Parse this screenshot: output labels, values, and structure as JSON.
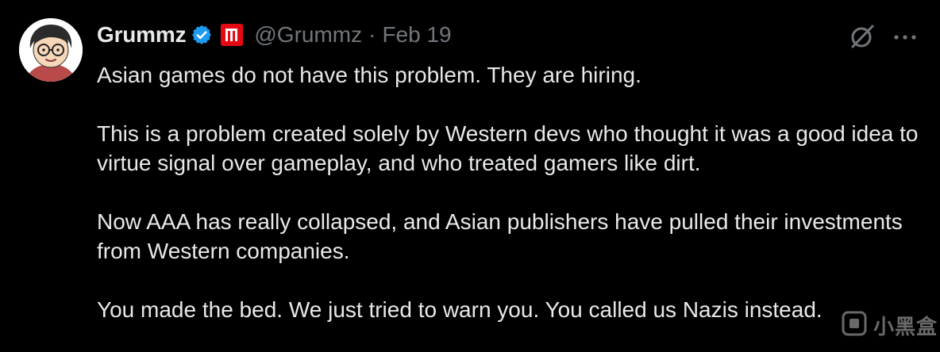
{
  "author": {
    "display_name": "Grummz",
    "handle": "@Grummz",
    "separator": "·",
    "date": "Feb 19",
    "avatar_icon": "cartoon-avatar",
    "verified_icon": "verified-check-icon",
    "affiliate_badge_icon": "red-affiliate-badge-icon",
    "verified_color": "#1d9bf0",
    "affiliate_color": "#e50914"
  },
  "actions": {
    "grok_icon": "grok-icon",
    "more_icon": "more-dots-icon"
  },
  "tweet": {
    "paragraphs": [
      "Asian games do not have this problem. They are hiring.",
      "This is a problem created solely by Western devs who thought it was a good idea to virtue signal over gameplay, and who treated gamers like dirt.",
      "Now AAA has really collapsed, and Asian publishers have pulled their investments from Western companies.",
      "You made the bed. We just tried to warn you. You called us Nazis instead."
    ]
  },
  "watermark": {
    "text": "小黑盒",
    "icon": "heybox-logo-icon"
  },
  "colors": {
    "background": "#000000",
    "primary_text": "#e7e9ea",
    "secondary_text": "#71767b"
  }
}
